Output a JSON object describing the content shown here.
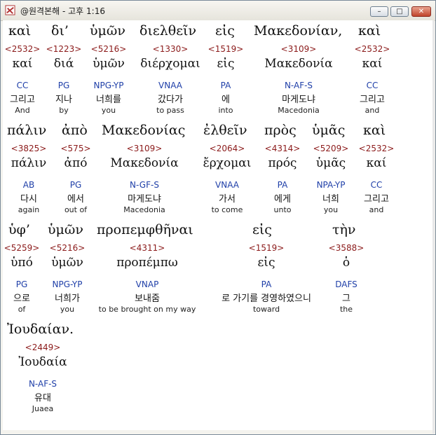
{
  "window": {
    "title": "@원격본해 - 고후 1:16",
    "buttons": {
      "min_glyph": "–",
      "max_glyph": "□",
      "close_glyph": "✕"
    }
  },
  "words": [
    {
      "greek": "καὶ",
      "strong": "<2532>",
      "lemma": "καί",
      "parse": "CC",
      "korean": "그리고",
      "english": "And"
    },
    {
      "greek": "δι’",
      "strong": "<1223>",
      "lemma": "διά",
      "parse": "PG",
      "korean": "지나",
      "english": "by"
    },
    {
      "greek": "ὑμῶν",
      "strong": "<5216>",
      "lemma": "ὑμῶν",
      "parse": "NPG-YP",
      "korean": "너희를",
      "english": "you"
    },
    {
      "greek": "διελθεῖν",
      "strong": "<1330>",
      "lemma": "διέρχομαι",
      "parse": "VNAA",
      "korean": "갔다가",
      "english": "to pass"
    },
    {
      "greek": "εἰς",
      "strong": "<1519>",
      "lemma": "εἰς",
      "parse": "PA",
      "korean": "에",
      "english": "into"
    },
    {
      "greek": "Μακεδονίαν,",
      "strong": "<3109>",
      "lemma": "Μακεδονία",
      "parse": "N-AF-S",
      "korean": "마게도냐",
      "english": "Macedonia"
    },
    {
      "greek": "καὶ",
      "strong": "<2532>",
      "lemma": "καί",
      "parse": "CC",
      "korean": "그리고",
      "english": "and"
    },
    {
      "greek": "πάλιν",
      "strong": "<3825>",
      "lemma": "πάλιν",
      "parse": "AB",
      "korean": "다시",
      "english": "again"
    },
    {
      "greek": "ἀπὸ",
      "strong": "<575>",
      "lemma": "ἀπό",
      "parse": "PG",
      "korean": "에서",
      "english": "out of"
    },
    {
      "greek": "Μακεδονίας",
      "strong": "<3109>",
      "lemma": "Μακεδονία",
      "parse": "N-GF-S",
      "korean": "마게도냐",
      "english": "Macedonia"
    },
    {
      "greek": "ἐλθεῖν",
      "strong": "<2064>",
      "lemma": "ἔρχομαι",
      "parse": "VNAA",
      "korean": "가서",
      "english": "to come"
    },
    {
      "greek": "πρὸς",
      "strong": "<4314>",
      "lemma": "πρός",
      "parse": "PA",
      "korean": "에게",
      "english": "unto"
    },
    {
      "greek": "ὑμᾶς",
      "strong": "<5209>",
      "lemma": "ὑμᾶς",
      "parse": "NPA-YP",
      "korean": "너희",
      "english": "you"
    },
    {
      "greek": "καὶ",
      "strong": "<2532>",
      "lemma": "καί",
      "parse": "CC",
      "korean": "그리고",
      "english": "and"
    },
    {
      "greek": "ὑφ’",
      "strong": "<5259>",
      "lemma": "ὑπό",
      "parse": "PG",
      "korean": "으로",
      "english": "of"
    },
    {
      "greek": "ὑμῶν",
      "strong": "<5216>",
      "lemma": "ὑμῶν",
      "parse": "NPG-YP",
      "korean": "너희가",
      "english": "you"
    },
    {
      "greek": "προπεμφθῆναι",
      "strong": "<4311>",
      "lemma": "προπέμπω",
      "parse": "VNAP",
      "korean": "보내줌",
      "english": "to be brought on my way"
    },
    {
      "greek": "εἰς",
      "strong": "<1519>",
      "lemma": "εἰς",
      "parse": "PA",
      "korean": "로 가기를 경영하였으니",
      "english": "toward"
    },
    {
      "greek": "τὴν",
      "strong": "<3588>",
      "lemma": "ὁ",
      "parse": "DAFS",
      "korean": "그",
      "english": "the"
    },
    {
      "greek": "Ἰουδαίαν.",
      "strong": "<2449>",
      "lemma": "Ἰουδαία",
      "parse": "N-AF-S",
      "korean": "유대",
      "english": "Juaea"
    }
  ]
}
